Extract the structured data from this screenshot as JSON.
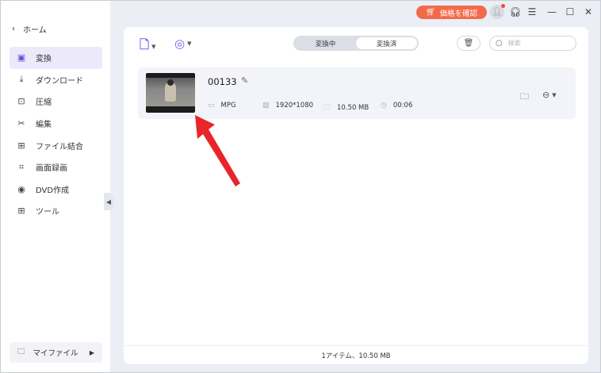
{
  "titlebar": {
    "price_button": "価格を確認",
    "accent": "#f26a4a"
  },
  "sidebar": {
    "home": "ホーム",
    "items": [
      {
        "label": "変換",
        "icon": "convert-icon",
        "active": true
      },
      {
        "label": "ダウンロード",
        "icon": "download-icon",
        "active": false
      },
      {
        "label": "圧縮",
        "icon": "compress-icon",
        "active": false
      },
      {
        "label": "編集",
        "icon": "scissors-icon",
        "active": false
      },
      {
        "label": "ファイル結合",
        "icon": "merge-icon",
        "active": false
      },
      {
        "label": "画面録画",
        "icon": "screen-record-icon",
        "active": false
      },
      {
        "label": "DVD作成",
        "icon": "dvd-icon",
        "active": false
      },
      {
        "label": "ツール",
        "icon": "grid-icon",
        "active": false
      }
    ],
    "my_files": "マイファイル"
  },
  "toolbar": {
    "tabs": [
      {
        "label": "変換中",
        "active": false
      },
      {
        "label": "変換済",
        "active": true
      }
    ],
    "search_placeholder": "検索"
  },
  "file": {
    "name": "00133",
    "format": "MPG",
    "resolution": "1920*1080",
    "size": "10.50 MB",
    "duration": "00:06"
  },
  "status": "1アイテム、10.50 MB",
  "colors": {
    "accent_purple": "#7b5cf0",
    "active_bg": "#ece9fb",
    "annotation_arrow": "#e8252b"
  }
}
